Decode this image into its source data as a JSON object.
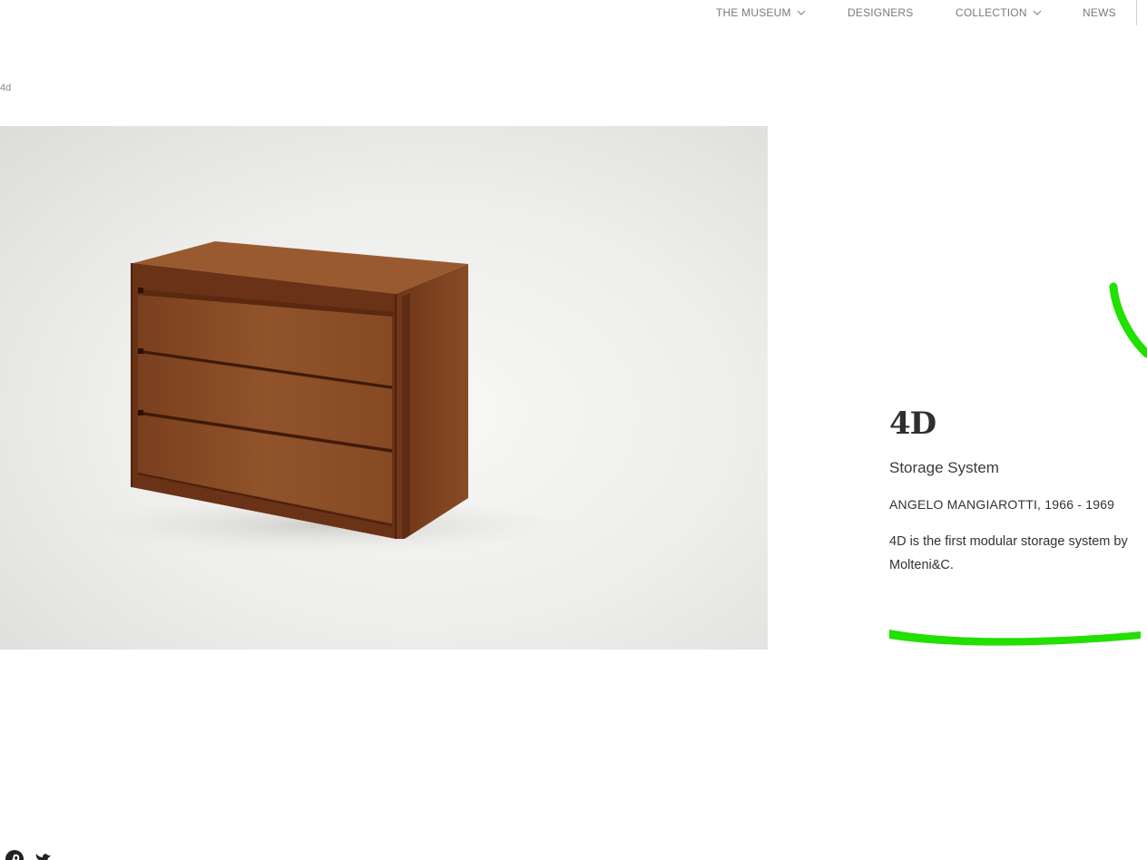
{
  "nav": {
    "museum": "THE MUSEUM",
    "designers": "DESIGNERS",
    "collection": "COLLECTION",
    "news": "NEWS"
  },
  "breadcrumb": "4d",
  "product": {
    "image_alt": "4D storage system chest of drawers in walnut wood",
    "title": "4D",
    "subtitle": "Storage System",
    "designer": "ANGELO MANGIAROTTI, 1966 - 1969",
    "description": "4D is the first modular storage system by Molteni&C."
  },
  "social": {
    "icons": [
      "pinterest-icon",
      "twitter-icon"
    ]
  },
  "colors": {
    "annotation": "#22e000",
    "wood": "#8a4a22"
  }
}
